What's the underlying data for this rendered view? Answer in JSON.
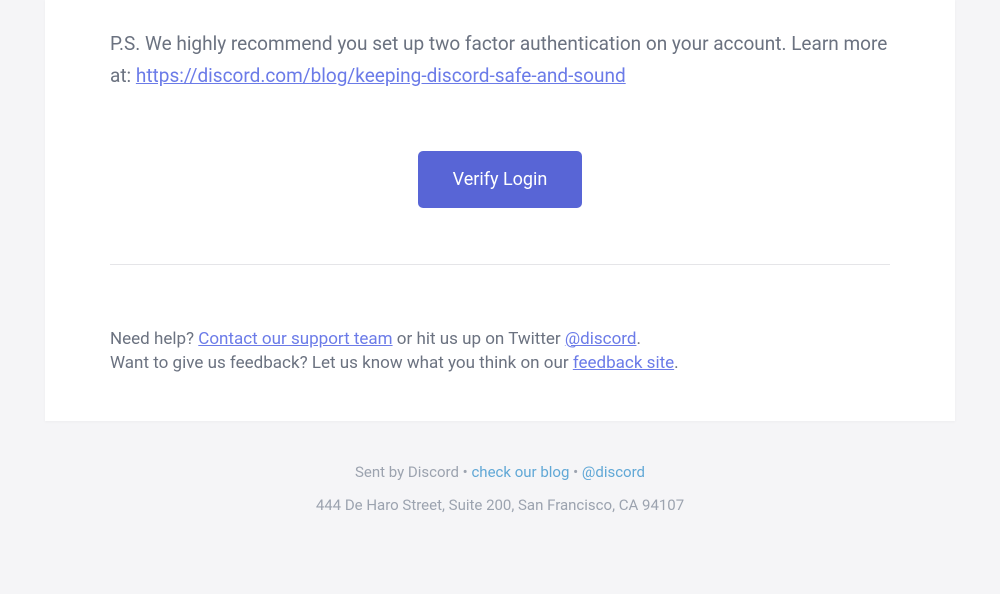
{
  "ps": {
    "prefix": "P.S. We highly recommend you set up two factor authentication on your account. Learn more at: ",
    "link_text": "https://discord.com/blog/keeping-discord-safe-and-sound"
  },
  "button": {
    "label": "Verify Login"
  },
  "help": {
    "line1_prefix": "Need help? ",
    "support_link": "Contact our support team",
    "line1_mid": " or hit us up on Twitter ",
    "twitter_handle": "@discord",
    "line1_suffix": ".",
    "line2_prefix": "Want to give us feedback? Let us know what you think on our ",
    "feedback_link": "feedback site",
    "line2_suffix": "."
  },
  "footer": {
    "sent_by": "Sent by Discord",
    "sep": " • ",
    "blog_link": "check our blog",
    "twitter_link": "@discord",
    "address": "444 De Haro Street, Suite 200, San Francisco, CA 94107"
  }
}
